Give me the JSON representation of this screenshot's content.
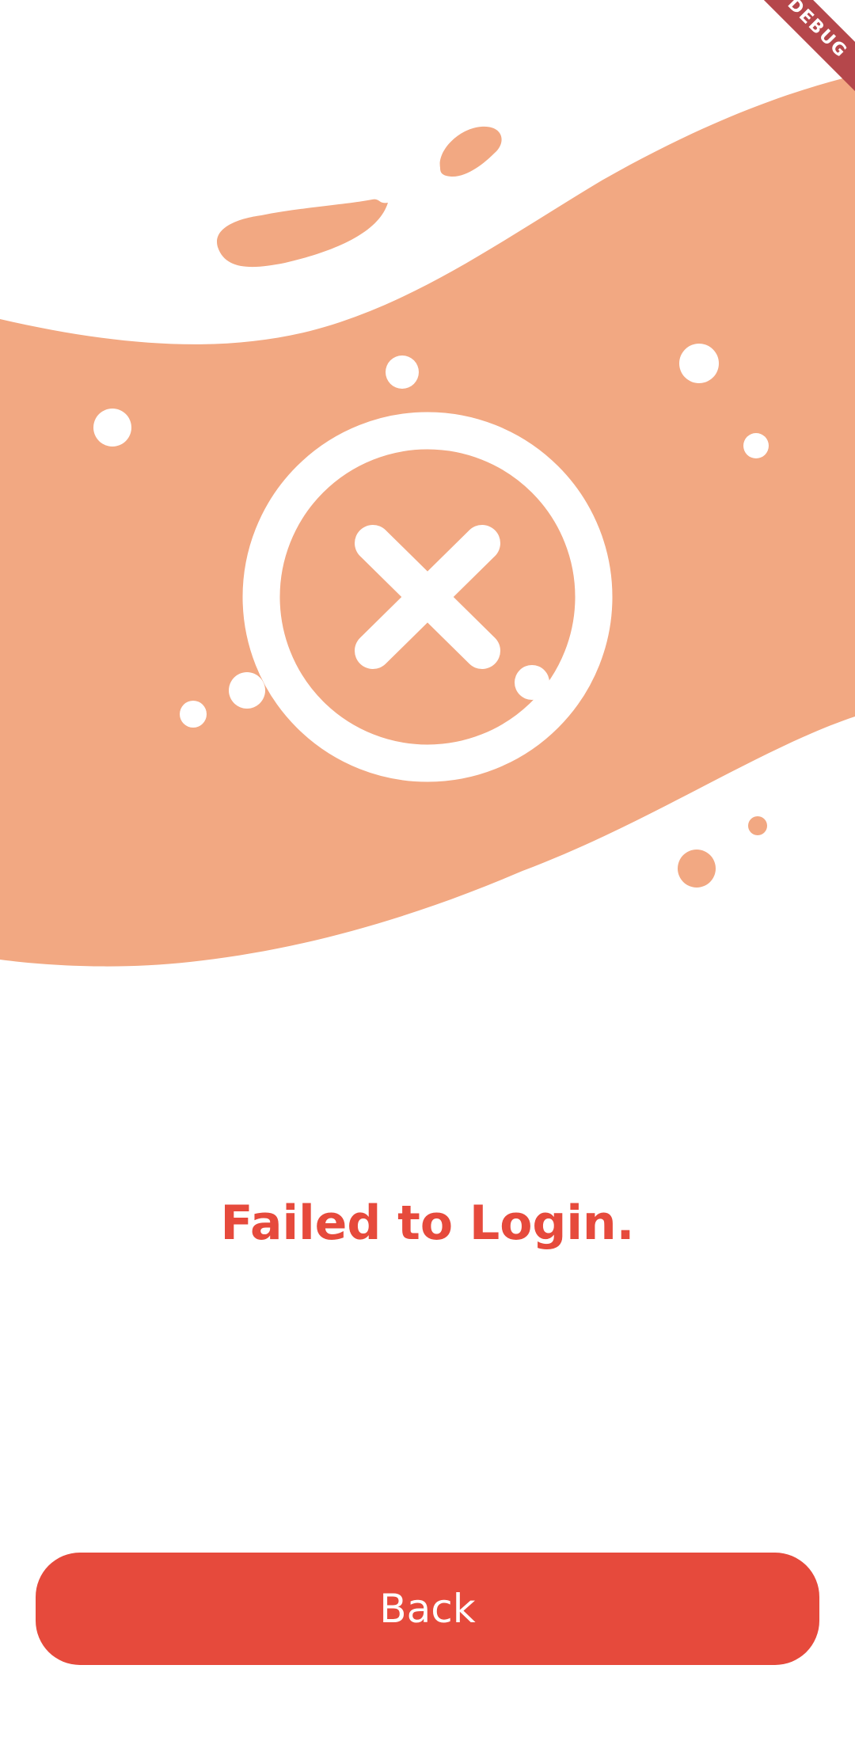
{
  "debug_banner": {
    "label": "DEBUG"
  },
  "illustration": {
    "icon": "close-circle-icon",
    "band_color": "#f2a882",
    "icon_color": "#ffffff"
  },
  "message": {
    "text": "Failed to Login."
  },
  "back_button": {
    "label": "Back"
  },
  "colors": {
    "accent": "#e64a3c",
    "background": "#ffffff",
    "debug_ribbon": "#b5474b"
  }
}
